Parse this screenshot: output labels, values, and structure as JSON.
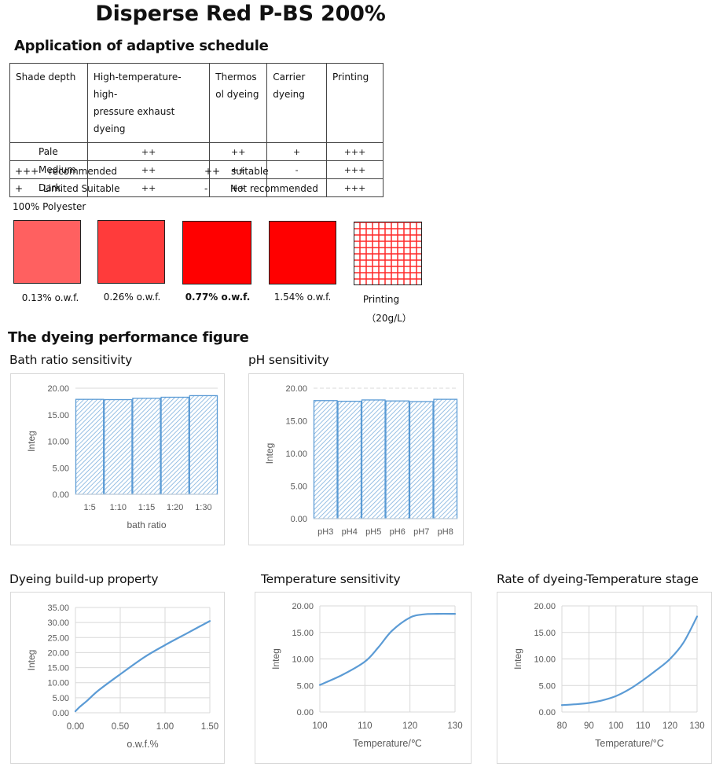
{
  "title": "Disperse Red P-BS 200%",
  "schedule": {
    "heading": "Application of adaptive schedule",
    "columns": [
      "Shade depth",
      "High-temperature-high-pressure exhaust dyeing",
      "Thermosol dyeing",
      "Carrier dyeing",
      "Printing"
    ],
    "columns_display": [
      "Shade depth",
      "High-temperature-high-\npressure exhaust dyeing",
      "Thermos\nol dyeing",
      "Carrier\ndyeing",
      "Printing"
    ],
    "rows": [
      {
        "shade": "Pale",
        "values": [
          "++",
          "++",
          "+",
          "+++"
        ]
      },
      {
        "shade": "Medium",
        "values": [
          "++",
          "++",
          "-",
          "+++"
        ]
      },
      {
        "shade": "Dark",
        "values": [
          "++",
          "++",
          "-",
          "+++"
        ]
      }
    ],
    "legend": [
      {
        "symbol": "+++",
        "meaning": "recommended"
      },
      {
        "symbol": "++",
        "meaning": "suitable"
      },
      {
        "symbol": "+",
        "meaning": "Limited Suitable"
      },
      {
        "symbol": "-",
        "meaning": "Not recommended"
      }
    ]
  },
  "substrate": "100% Polyester",
  "swatches": [
    {
      "label": "0.13% o.w.f.",
      "color": "#ff6060",
      "bold": false
    },
    {
      "label": "0.26% o.w.f.",
      "color": "#ff3b3b",
      "bold": false
    },
    {
      "label": "0.77% o.w.f.",
      "color": "#ff0000",
      "bold": true
    },
    {
      "label": "1.54% o.w.f.",
      "color": "#ff0000",
      "bold": false
    },
    {
      "label": "Printing",
      "sublabel": "（20g/L）",
      "color": "#ff3030",
      "pattern": "grid",
      "bold": false
    }
  ],
  "performance_heading": "The dyeing performance figure",
  "colors": {
    "series": "#5b9bd5",
    "grid": "#d9d9d9",
    "axis_text": "#595959"
  },
  "chart_data": [
    {
      "id": "bath",
      "type": "bar",
      "title": "Bath ratio sensitivity",
      "xlabel": "bath ratio",
      "ylabel": "Integ",
      "categories": [
        "1:5",
        "1:10",
        "1:15",
        "1:20",
        "1:30"
      ],
      "values": [
        17.9,
        17.85,
        18.1,
        18.3,
        18.6
      ],
      "ylim": [
        0,
        20
      ],
      "yticks": [
        "0.00",
        "5.00",
        "10.00",
        "15.00",
        "20.00"
      ],
      "grid": "horizontal-top",
      "fill": "hatched"
    },
    {
      "id": "ph",
      "type": "bar",
      "title": "pH sensitivity",
      "xlabel": "",
      "ylabel": "Integ",
      "categories": [
        "pH3",
        "pH4",
        "pH5",
        "pH6",
        "pH7",
        "pH8"
      ],
      "values": [
        18.1,
        18.0,
        18.2,
        18.05,
        17.95,
        18.3
      ],
      "ylim": [
        0,
        20
      ],
      "yticks": [
        "0.00",
        "5.00",
        "10.00",
        "15.00",
        "20.00"
      ],
      "grid": "horizontal-top-dashed",
      "fill": "hatched"
    },
    {
      "id": "buildup",
      "type": "line",
      "title": "Dyeing build-up property",
      "xlabel": "o.w.f.%",
      "ylabel": "Integ",
      "x": [
        0.0,
        0.05,
        0.13,
        0.26,
        0.5,
        0.77,
        1.0,
        1.25,
        1.5
      ],
      "y": [
        0.5,
        2.0,
        4.0,
        7.5,
        12.8,
        18.5,
        22.5,
        26.5,
        30.5
      ],
      "xlim": [
        0,
        1.5
      ],
      "ylim": [
        0,
        35
      ],
      "xticks": [
        "0.00",
        "0.50",
        "1.00",
        "1.50"
      ],
      "yticks": [
        "0.00",
        "5.00",
        "10.00",
        "15.00",
        "20.00",
        "25.00",
        "30.00",
        "35.00"
      ],
      "grid": "both"
    },
    {
      "id": "tempsens",
      "type": "line",
      "title": "Temperature sensitivity",
      "xlabel": "Temperature/℃",
      "ylabel": "Integ",
      "x": [
        100,
        105,
        110,
        113,
        116,
        120,
        123,
        126,
        130
      ],
      "y": [
        5.1,
        7.0,
        9.5,
        12.2,
        15.3,
        17.8,
        18.4,
        18.5,
        18.5
      ],
      "xlim": [
        100,
        130
      ],
      "ylim": [
        0,
        20
      ],
      "xticks": [
        "100",
        "110",
        "120",
        "130"
      ],
      "yticks": [
        "0.00",
        "5.00",
        "10.00",
        "15.00",
        "20.00"
      ],
      "grid": "both"
    },
    {
      "id": "rate",
      "type": "line",
      "title": "Rate of dyeing-Temperature stage",
      "xlabel": "Temperature/°C",
      "ylabel": "Integ",
      "x": [
        80,
        85,
        90,
        95,
        100,
        105,
        110,
        115,
        120,
        125,
        130
      ],
      "y": [
        1.3,
        1.45,
        1.7,
        2.2,
        3.0,
        4.3,
        6.0,
        7.9,
        10.0,
        13.1,
        18.0
      ],
      "xlim": [
        80,
        130
      ],
      "ylim": [
        0,
        20
      ],
      "xticks": [
        "80",
        "90",
        "100",
        "110",
        "120",
        "130"
      ],
      "yticks": [
        "0.00",
        "5.00",
        "10.00",
        "15.00",
        "20.00"
      ],
      "grid": "both"
    }
  ]
}
